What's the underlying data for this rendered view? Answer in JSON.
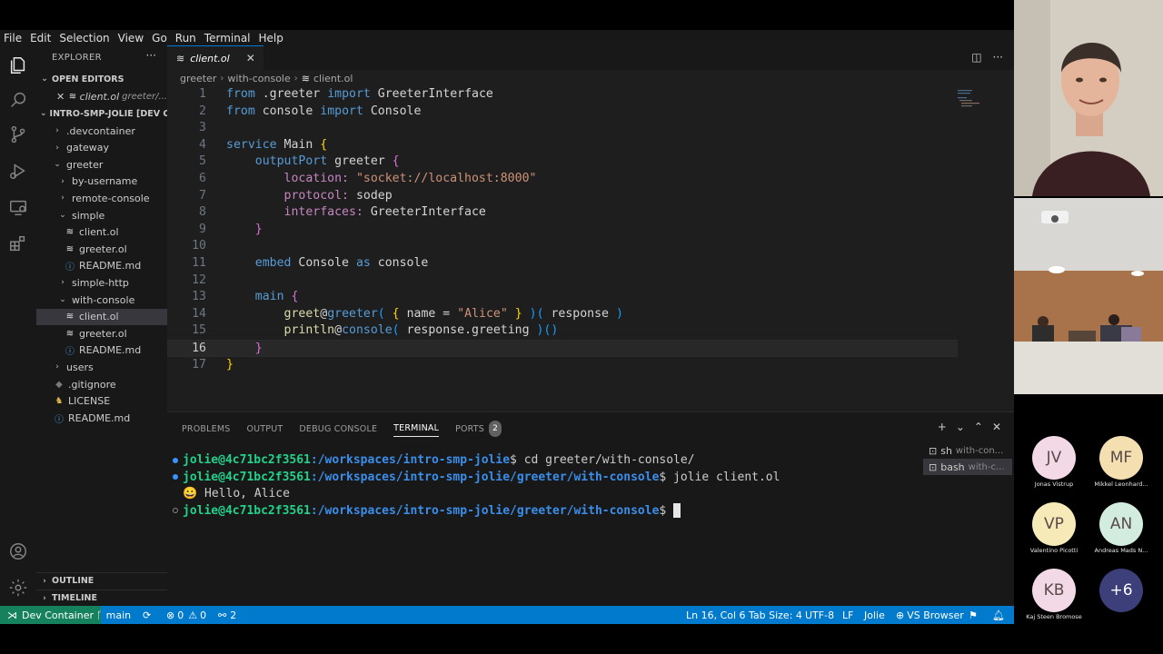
{
  "menu": [
    "File",
    "Edit",
    "Selection",
    "View",
    "Go",
    "Run",
    "Terminal",
    "Help"
  ],
  "sidebar": {
    "title": "EXPLORER",
    "open_editors_header": "OPEN EDITORS",
    "open_editor": {
      "name": "client.ol",
      "path": "greeter/..."
    },
    "project_header": "INTRO-SMP-JOLIE [DEV C...",
    "tree": [
      {
        "label": ".devcontainer",
        "kind": "folder-closed"
      },
      {
        "label": "gateway",
        "kind": "folder-closed"
      },
      {
        "label": "greeter",
        "kind": "folder-open"
      },
      {
        "label": "by-username",
        "kind": "folder-closed"
      },
      {
        "label": "remote-console",
        "kind": "folder-closed"
      },
      {
        "label": "simple",
        "kind": "folder-open"
      },
      {
        "label": "client.ol",
        "kind": "jolie"
      },
      {
        "label": "greeter.ol",
        "kind": "jolie"
      },
      {
        "label": "README.md",
        "kind": "info"
      },
      {
        "label": "simple-http",
        "kind": "folder-closed"
      },
      {
        "label": "with-console",
        "kind": "folder-open"
      },
      {
        "label": "client.ol",
        "kind": "jolie"
      },
      {
        "label": "greeter.ol",
        "kind": "jolie"
      },
      {
        "label": "README.md",
        "kind": "info"
      },
      {
        "label": "users",
        "kind": "folder-closed"
      },
      {
        "label": ".gitignore",
        "kind": "git"
      },
      {
        "label": "LICENSE",
        "kind": "license"
      },
      {
        "label": "README.md",
        "kind": "info"
      }
    ],
    "outline": "OUTLINE",
    "timeline": "TIMELINE"
  },
  "editor": {
    "tab_label": "client.ol",
    "breadcrumb": [
      "greeter",
      "with-console",
      "client.ol"
    ],
    "cursor_line": 16
  },
  "panel": {
    "tabs": [
      "PROBLEMS",
      "OUTPUT",
      "DEBUG CONSOLE",
      "TERMINAL",
      "PORTS"
    ],
    "ports_count": "2",
    "terminal_lines": [
      {
        "user": "jolie@4c71bc2f3561",
        "path": ":/workspaces/intro-smp-jolie",
        "cmd": "$ cd greeter/with-console/"
      },
      {
        "user": "jolie@4c71bc2f3561",
        "path": ":/workspaces/intro-smp-jolie/greeter/with-console",
        "cmd": "$ jolie client.ol"
      },
      {
        "output": "😀 Hello, Alice"
      },
      {
        "user": "jolie@4c71bc2f3561",
        "path": ":/workspaces/intro-smp-jolie/greeter/with-console",
        "cmd": "$ "
      }
    ],
    "terminal_list": [
      {
        "name": "sh",
        "detail": "with-con..."
      },
      {
        "name": "bash",
        "detail": "with-c..."
      }
    ]
  },
  "status": {
    "remote": "Dev Container",
    "branch": "main",
    "errors": "0",
    "warnings": "0",
    "ports": "2",
    "position": "Ln 16, Col 6",
    "tab_size": "Tab Size: 4",
    "encoding": "UTF-8",
    "eol": "LF",
    "language": "Jolie",
    "browser": "VS Browser"
  },
  "participants": [
    {
      "initials": "JV",
      "name": "Jonas Vistrup",
      "color": "#f3d8e6"
    },
    {
      "initials": "MF",
      "name": "Mikkel Leonhard...",
      "color": "#f3dfb0"
    },
    {
      "initials": "VP",
      "name": "Valentino Picotti",
      "color": "#f6eab8"
    },
    {
      "initials": "AN",
      "name": "Andreas Mads N...",
      "color": "#d3ece0"
    },
    {
      "initials": "KB",
      "name": "Kaj Steen Bromose",
      "color": "#f3d8e6"
    },
    {
      "initials": "+6",
      "name": "",
      "color": "#3c3f7a"
    }
  ]
}
